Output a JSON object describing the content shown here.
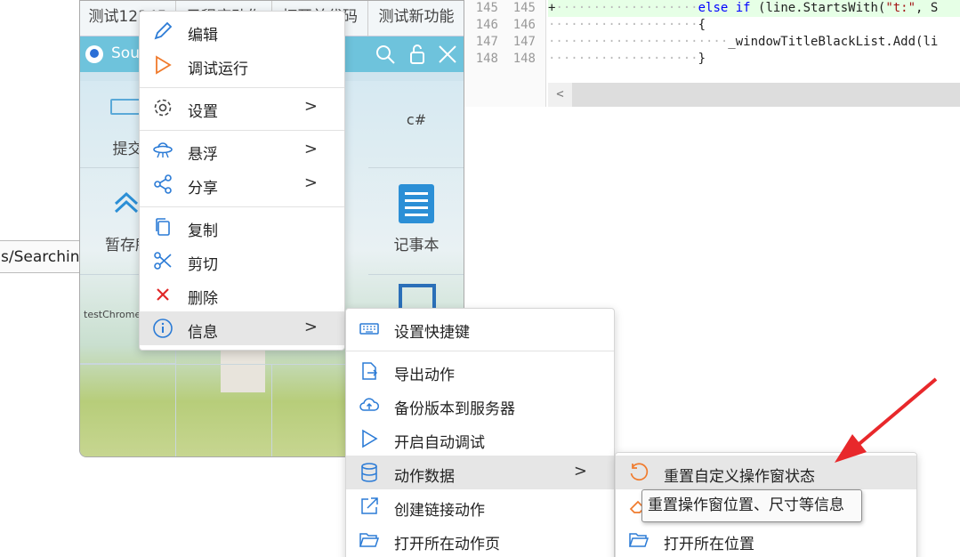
{
  "editor": {
    "lines": [
      {
        "old": "145",
        "new": "145",
        "marker": "+",
        "code_kw1": "else if",
        "code_mid": " (line.StartsWith(",
        "code_str": "\"t:\"",
        "code_tail": ", S"
      },
      {
        "old": "146",
        "new": "146",
        "code": "{"
      },
      {
        "old": "147",
        "new": "147",
        "code": "_windowTitleBlackList.Add(li"
      },
      {
        "old": "148",
        "new": "148",
        "code": "}"
      }
    ],
    "scroll_left_glyph": "<"
  },
  "left_input": {
    "value": "s/Searching"
  },
  "app": {
    "tabs": [
      "测试12345",
      "子程序动作",
      "打开并代码",
      "测试新功能"
    ],
    "toolbar_title": "Sou",
    "cells": {
      "submit": "提交",
      "csharp": "c#",
      "stash": "暂存所",
      "notepad": "记事本",
      "testchrome": "testChrome"
    }
  },
  "menu1": {
    "items": [
      {
        "icon": "pencil-icon",
        "label": "编辑"
      },
      {
        "icon": "play-icon",
        "label": "调试运行"
      },
      {
        "icon": "gear-icon",
        "label": "设置",
        "arrow": ">"
      },
      {
        "icon": "ufo-icon",
        "label": "悬浮",
        "arrow": ">"
      },
      {
        "icon": "share-icon",
        "label": "分享",
        "arrow": ">"
      },
      {
        "icon": "copy-icon",
        "label": "复制"
      },
      {
        "icon": "scissors-icon",
        "label": "剪切"
      },
      {
        "icon": "delete-x-icon",
        "label": "删除"
      },
      {
        "icon": "info-icon",
        "label": "信息",
        "arrow": ">"
      }
    ]
  },
  "menu2": {
    "items": [
      {
        "icon": "keyboard-icon",
        "label": "设置快捷键"
      },
      {
        "icon": "export-icon",
        "label": "导出动作"
      },
      {
        "icon": "cloud-upload-icon",
        "label": "备份版本到服务器"
      },
      {
        "icon": "play-outline-icon",
        "label": "开启自动调试"
      },
      {
        "icon": "database-icon",
        "label": "动作数据",
        "arrow": ">"
      },
      {
        "icon": "external-link-icon",
        "label": "创建链接动作"
      },
      {
        "icon": "folder-open-icon",
        "label": "打开所在动作页"
      }
    ]
  },
  "menu3": {
    "items": [
      {
        "icon": "reset-icon",
        "label": "重置自定义操作窗状态"
      },
      {
        "icon": "eraser-icon",
        "label": ""
      },
      {
        "icon": "folder-open-icon",
        "label": "打开所在位置"
      }
    ]
  },
  "tooltip": {
    "text": "重置操作窗位置、尺寸等信息"
  },
  "colors": {
    "accent_blue": "#2b8fd6",
    "toolbar": "#6ec3dc",
    "arrow_red": "#e8282b",
    "orange": "#f07b2d"
  }
}
